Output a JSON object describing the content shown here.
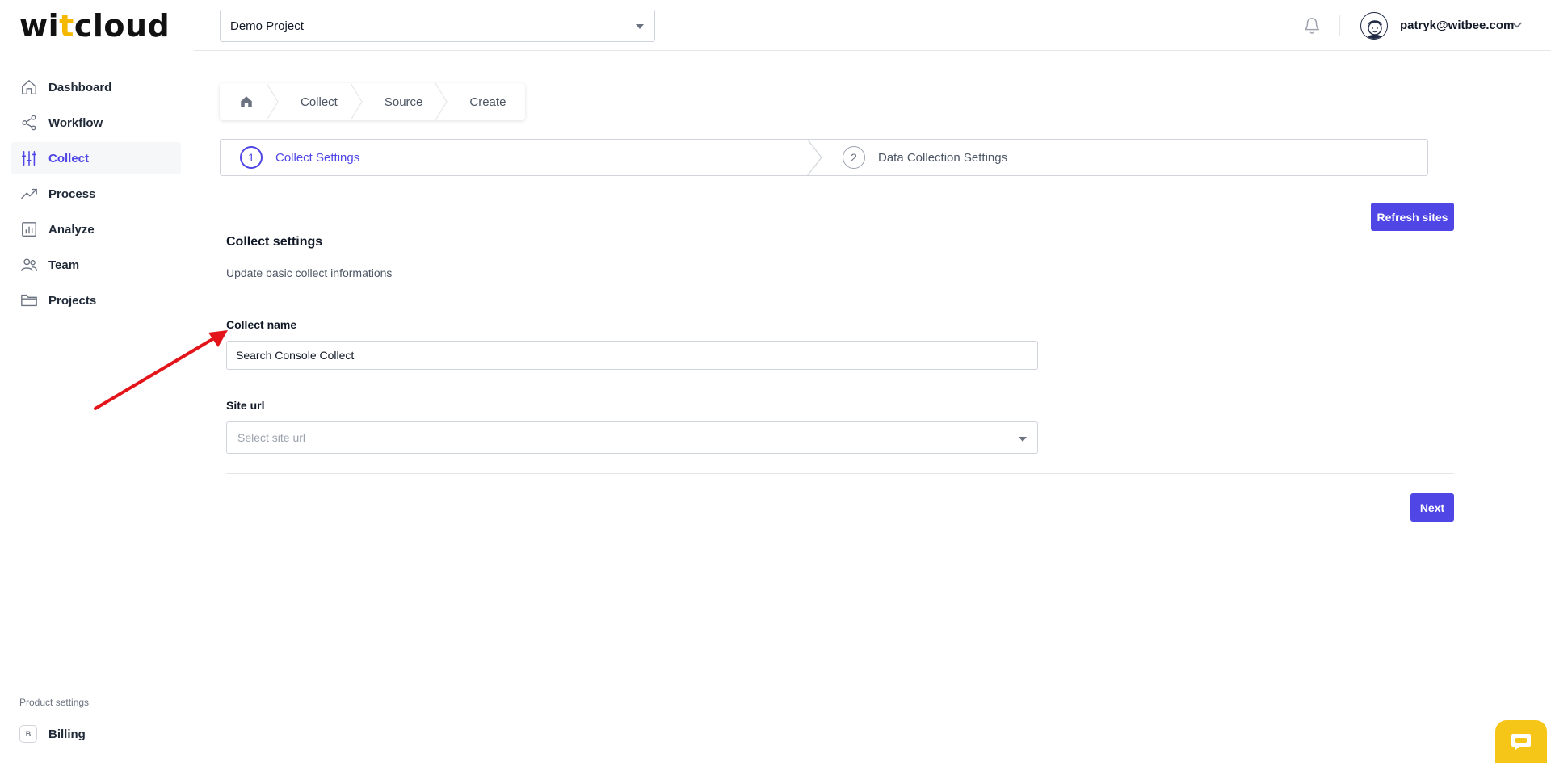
{
  "logo": {
    "part1": "wi",
    "part2": "t",
    "part3": "cloud"
  },
  "header": {
    "project_selected": "Demo Project",
    "user_email": "patryk@witbee.com"
  },
  "sidebar": {
    "items": [
      {
        "label": "Dashboard",
        "icon": "home-icon"
      },
      {
        "label": "Workflow",
        "icon": "share-icon"
      },
      {
        "label": "Collect",
        "icon": "sliders-icon",
        "active": true
      },
      {
        "label": "Process",
        "icon": "trending-up-icon"
      },
      {
        "label": "Analyze",
        "icon": "bar-chart-icon"
      },
      {
        "label": "Team",
        "icon": "users-icon"
      },
      {
        "label": "Projects",
        "icon": "folder-icon"
      }
    ],
    "product_settings_label": "Product settings",
    "billing_badge": "B",
    "billing_label": "Billing"
  },
  "breadcrumb": [
    "Collect",
    "Source",
    "Create"
  ],
  "stepper": {
    "steps": [
      {
        "num": "1",
        "label": "Collect Settings",
        "active": true
      },
      {
        "num": "2",
        "label": "Data Collection Settings",
        "active": false
      }
    ]
  },
  "content": {
    "refresh_button": "Refresh sites",
    "section_title": "Collect settings",
    "section_desc": "Update basic collect informations",
    "collect_name_label": "Collect name",
    "collect_name_value": "Search Console Collect",
    "site_url_label": "Site url",
    "site_url_placeholder": "Select site url",
    "next_button": "Next"
  },
  "colors": {
    "accent": "#4f46e5",
    "logo_accent": "#f5b800",
    "chat_widget": "#f5c518",
    "annotation_arrow": "#e3151a"
  }
}
